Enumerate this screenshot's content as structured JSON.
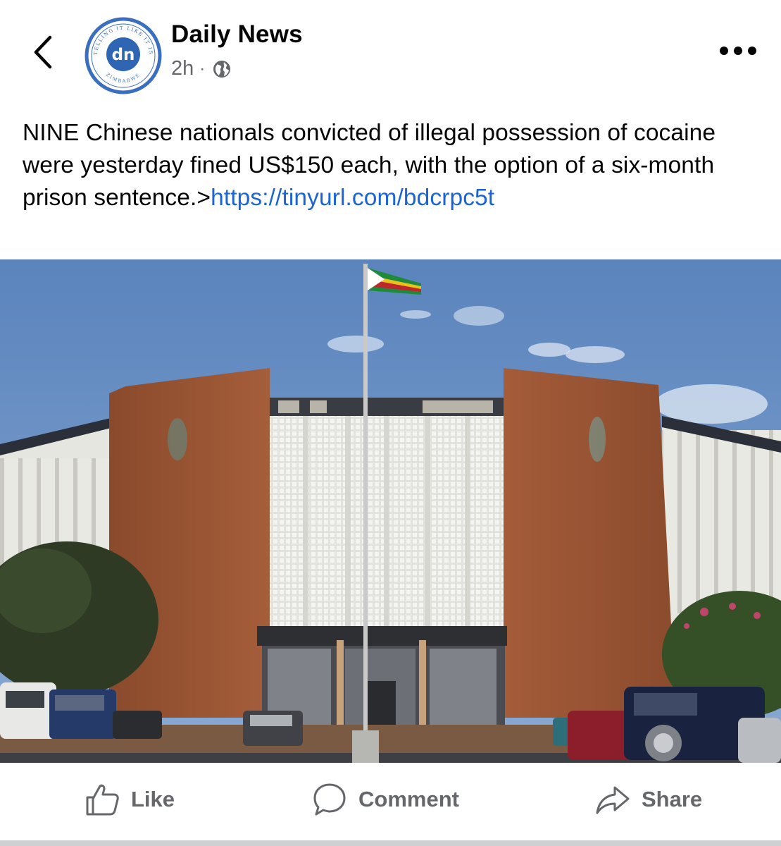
{
  "header": {
    "back_icon": "chevron-left-icon",
    "page_name": "Daily News",
    "time_ago": "2h",
    "separator": "·",
    "audience_icon": "globe-icon",
    "more_icon": "more-horizontal-icon",
    "avatar": {
      "monogram": "dn",
      "ring_text_top": "TELLING IT LIKE IT IS",
      "ring_text_bottom": "ZIMBABWE",
      "brand_color": "#2f66b3",
      "ring_color": "#3a6fbf"
    }
  },
  "post": {
    "text": "NINE Chinese nationals convicted of illegal possession of cocaine were yesterday fined US$150 each, with the option of a six-month prison sentence.>",
    "link_text": "https://tinyurl.com/bdcrpc5t",
    "link_color": "#1a64d6"
  },
  "photo": {
    "subject": "brick-building-photo"
  },
  "actions": {
    "like_label": "Like",
    "comment_label": "Comment",
    "share_label": "Share",
    "label_color": "#65676b"
  }
}
